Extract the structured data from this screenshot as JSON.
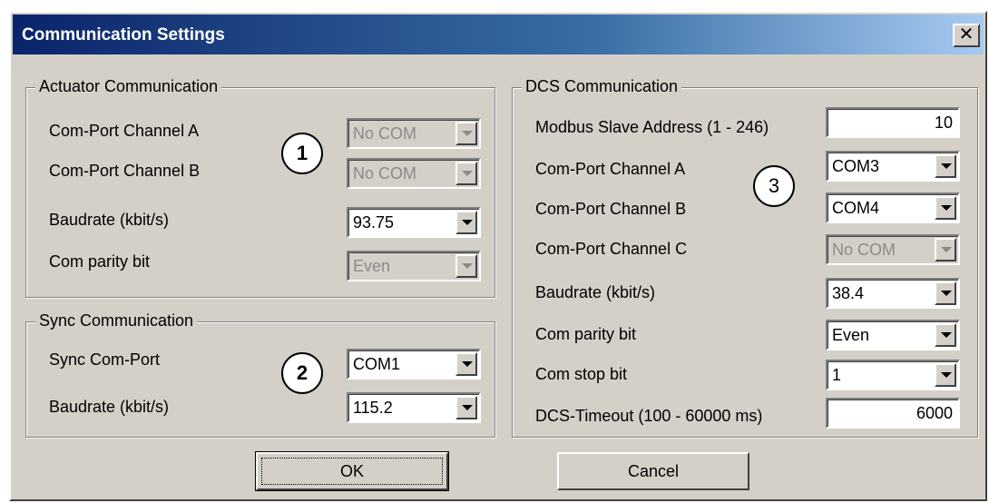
{
  "window": {
    "title": "Communication Settings",
    "close_glyph": "✕"
  },
  "actuator": {
    "legend": "Actuator Communication",
    "fields": [
      {
        "label": "Com-Port Channel A",
        "value": "No COM",
        "disabled": true
      },
      {
        "label": "Com-Port Channel B",
        "value": "No COM",
        "disabled": true
      },
      {
        "label": "Baudrate (kbit/s)",
        "value": "93.75",
        "disabled": false
      },
      {
        "label": "Com parity bit",
        "value": "Even",
        "disabled": true
      }
    ],
    "marker": "1"
  },
  "sync": {
    "legend": "Sync Communication",
    "fields": [
      {
        "label": "Sync Com-Port",
        "value": "COM1",
        "disabled": false
      },
      {
        "label": "Baudrate (kbit/s)",
        "value": "115.2",
        "disabled": false
      }
    ],
    "marker": "2"
  },
  "dcs": {
    "legend": "DCS Communication",
    "modbus": {
      "label": "Modbus Slave Address (1 - 246)",
      "value": "10"
    },
    "fields": [
      {
        "label": "Com-Port Channel A",
        "value": "COM3",
        "disabled": false
      },
      {
        "label": "Com-Port Channel B",
        "value": "COM4",
        "disabled": false
      },
      {
        "label": "Com-Port Channel C",
        "value": "No COM",
        "disabled": true
      },
      {
        "label": "Baudrate (kbit/s)",
        "value": "38.4",
        "disabled": false
      },
      {
        "label": "Com parity bit",
        "value": "Even",
        "disabled": false
      },
      {
        "label": "Com stop bit",
        "value": "1",
        "disabled": false
      }
    ],
    "timeout": {
      "label": "DCS-Timeout (100 - 60000 ms)",
      "value": "6000"
    },
    "marker": "3"
  },
  "buttons": {
    "ok": "OK",
    "cancel": "Cancel"
  }
}
